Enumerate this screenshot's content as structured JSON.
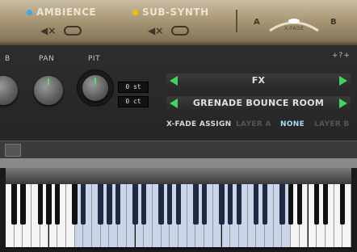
{
  "header": {
    "layer_a": {
      "label": "AMBIENCE",
      "dot_color": "#3aa9e6",
      "mute_icon": "mute-icon",
      "link_icon": "link-icon"
    },
    "layer_b": {
      "label": "SUB-SYNTH",
      "dot_color": "#f0c000",
      "mute_icon": "mute-icon",
      "link_icon": "link-icon"
    },
    "xfade": {
      "a": "A",
      "b": "B",
      "label": "X-FADE"
    }
  },
  "panel": {
    "help": "+?+",
    "knobs": [
      {
        "label": "B",
        "id": "cut"
      },
      {
        "label": "PAN",
        "id": "pan"
      },
      {
        "label": "PIT",
        "id": "pit"
      }
    ],
    "pitch_values": [
      "0 st",
      "0 ct"
    ],
    "selector_category": "FX",
    "selector_preset": "GRENADE BOUNCE ROOM",
    "xfade_assign": {
      "title": "X-FADE ASSIGN",
      "layer_a": "LAYER A",
      "none": "NONE",
      "layer_b": "LAYER B"
    },
    "accent": "#3fd65b"
  }
}
